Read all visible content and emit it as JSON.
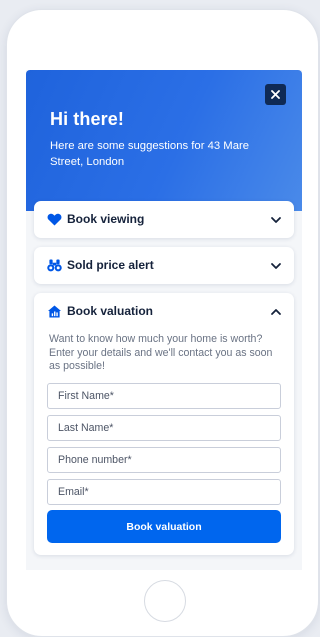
{
  "hero": {
    "title": "Hi there!",
    "subtitle": "Here are some suggestions for 43 Mare Street, London",
    "close_icon": "close-icon"
  },
  "cards": {
    "book_viewing": {
      "title": "Book viewing",
      "icon": "heart-icon",
      "chevron": "chevron-down-icon"
    },
    "sold_price": {
      "title": "Sold price alert",
      "icon": "binoculars-icon",
      "chevron": "chevron-down-icon"
    },
    "book_valuation": {
      "title": "Book valuation",
      "icon": "house-icon",
      "chevron": "chevron-up-icon",
      "description": "Want to know how much your home is worth? Enter your details and we'll contact you as soon as possible!",
      "fields": {
        "first_name": "First Name*",
        "last_name": "Last Name*",
        "phone": "Phone number*",
        "email": "Email*"
      },
      "submit_label": "Book valuation"
    }
  },
  "colors": {
    "brand": "#1f63dc",
    "button": "#0066ee",
    "close_bg": "#0f2a55"
  }
}
